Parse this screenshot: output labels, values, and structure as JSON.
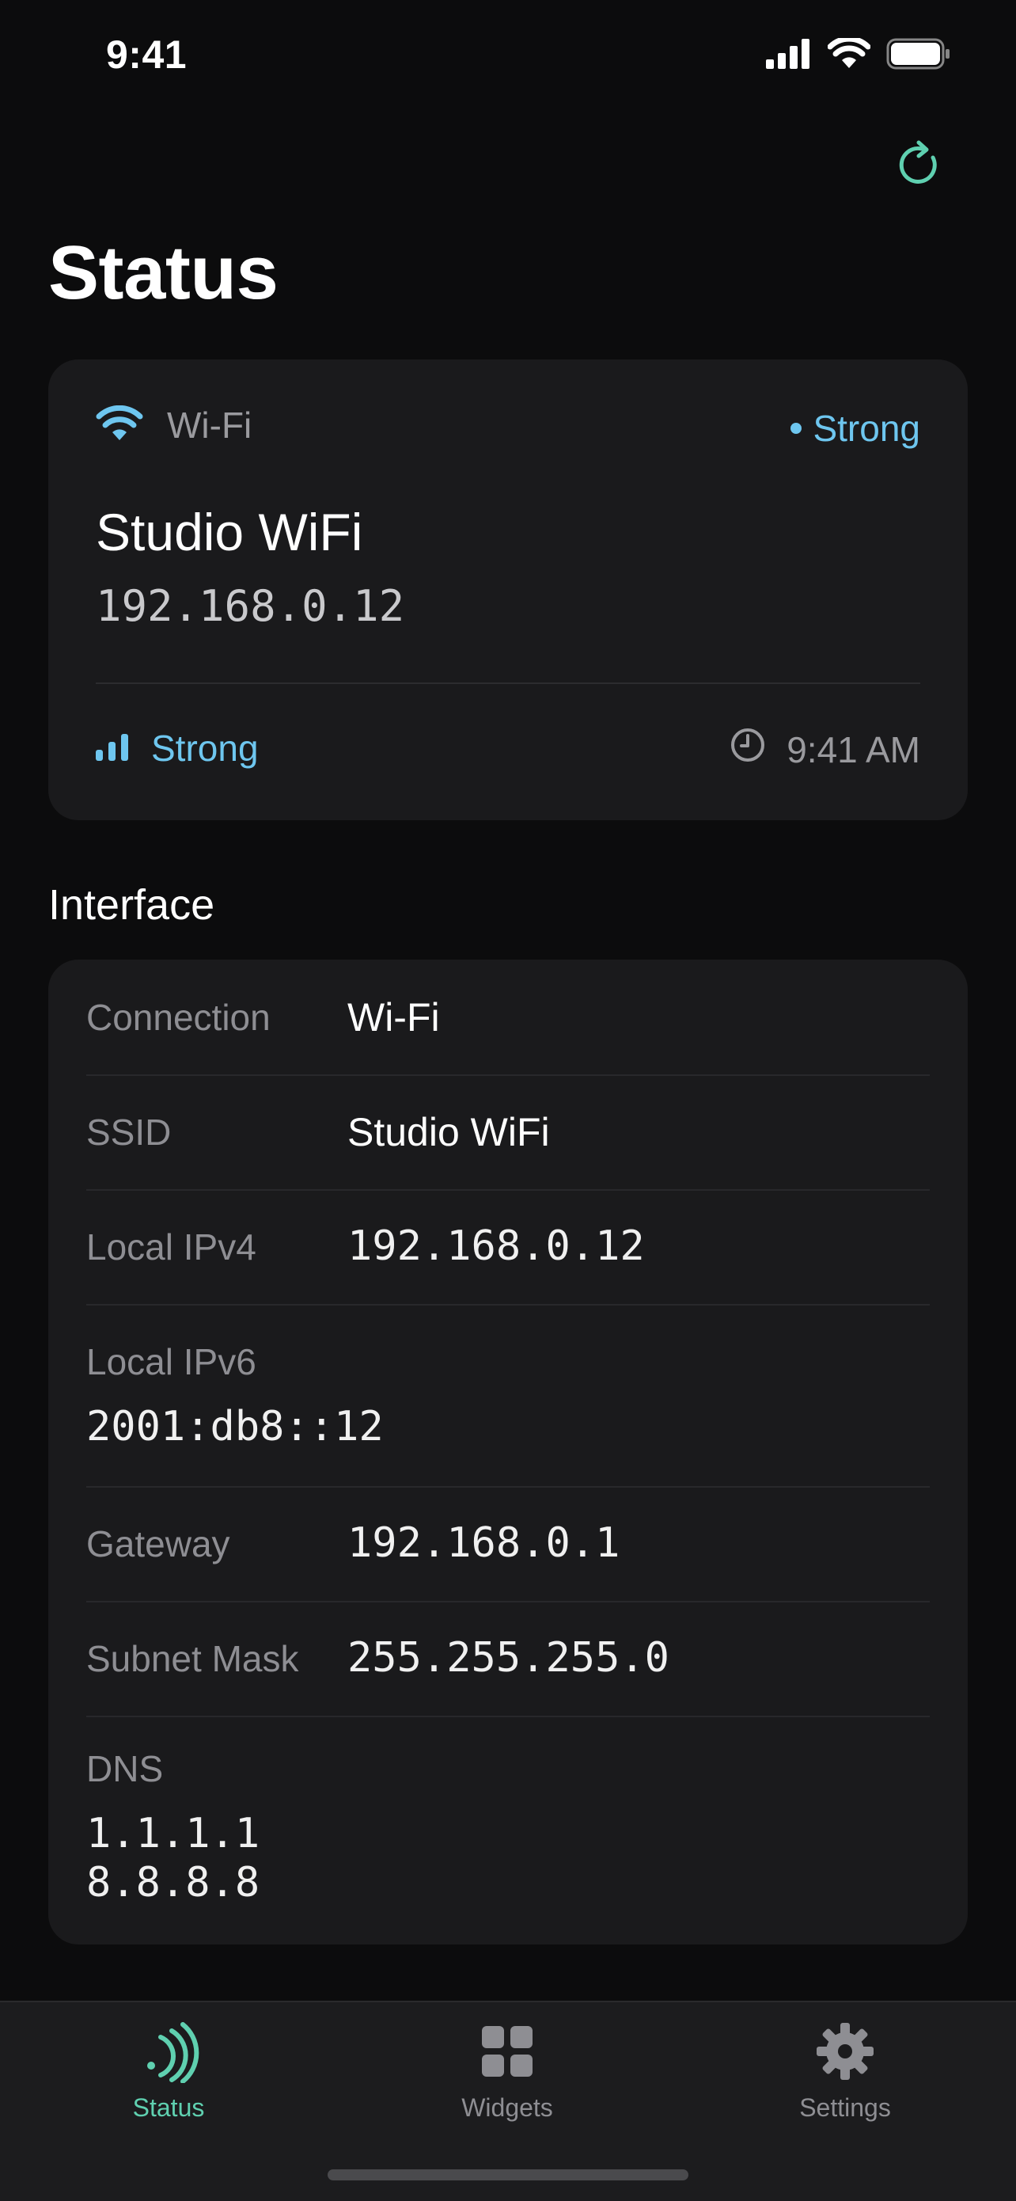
{
  "status_bar": {
    "time": "9:41"
  },
  "page": {
    "title": "Status"
  },
  "wifi_card": {
    "type_label": "Wi-Fi",
    "signal_label": "Strong",
    "network_name": "Studio WiFi",
    "ip_address": "192.168.0.12",
    "strength_label": "Strong",
    "updated_time": "9:41 AM"
  },
  "interface": {
    "section_title": "Interface",
    "connection": {
      "label": "Connection",
      "value": "Wi-Fi"
    },
    "ssid": {
      "label": "SSID",
      "value": "Studio WiFi"
    },
    "ipv4": {
      "label": "Local IPv4",
      "value": "192.168.0.12"
    },
    "ipv6": {
      "label": "Local IPv6",
      "value": "2001:db8::12"
    },
    "gateway": {
      "label": "Gateway",
      "value": "192.168.0.1"
    },
    "subnet": {
      "label": "Subnet Mask",
      "value": "255.255.255.0"
    },
    "dns": {
      "label": "DNS",
      "values": [
        "1.1.1.1",
        "8.8.8.8"
      ]
    }
  },
  "tabs": [
    {
      "label": "Status",
      "icon": "signal-waves-icon",
      "active": true
    },
    {
      "label": "Widgets",
      "icon": "grid-icon",
      "active": false
    },
    {
      "label": "Settings",
      "icon": "gear-icon",
      "active": false
    }
  ],
  "colors": {
    "accent_teal": "#5fd0b0",
    "accent_blue": "#6ec6ef",
    "card_bg": "#1a1a1c",
    "page_bg": "#0c0c0d"
  }
}
